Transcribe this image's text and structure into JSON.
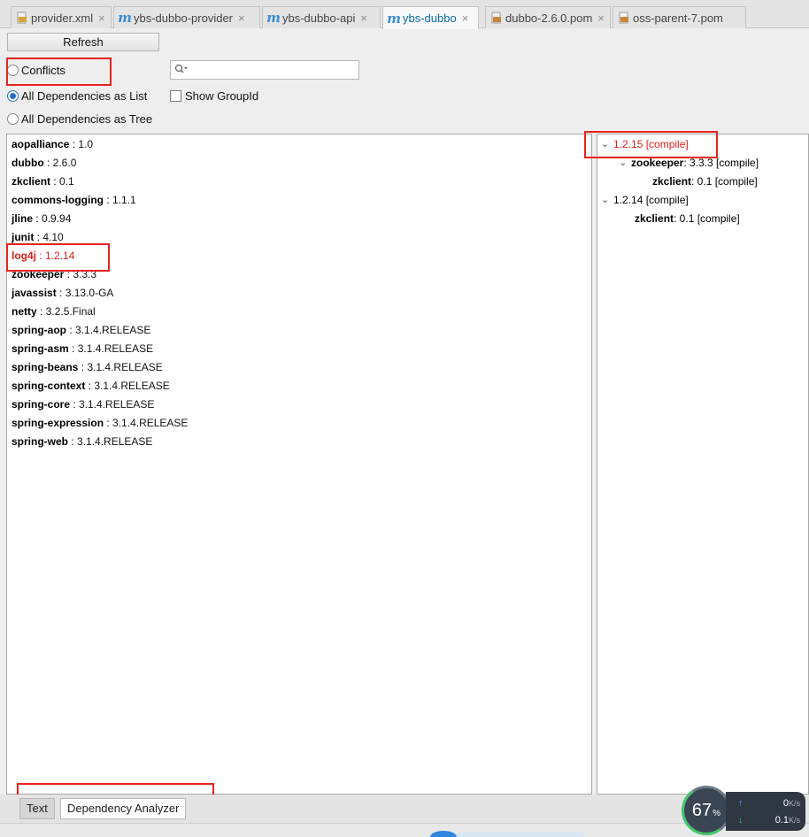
{
  "tabs": [
    {
      "label": "provider.xml",
      "icon": "xml-file-icon"
    },
    {
      "label": "ybs-dubbo-provider",
      "icon": "maven-icon"
    },
    {
      "label": "ybs-dubbo-api",
      "icon": "maven-icon"
    },
    {
      "label": "ybs-dubbo",
      "icon": "maven-icon",
      "active": true
    },
    {
      "label": "dubbo-2.6.0.pom",
      "icon": "pom-file-icon"
    },
    {
      "label": "oss-parent-7.pom",
      "icon": "pom-file-icon"
    }
  ],
  "tab_close_glyph": "×",
  "toolbar": {
    "refresh_label": "Refresh",
    "conflicts_label": "Conflicts",
    "list_label": "All Dependencies as List",
    "tree_label": "All Dependencies as Tree",
    "show_groupid_label": "Show GroupId",
    "view_mode": "list",
    "show_groupid": false,
    "search_value": ""
  },
  "dependencies": [
    {
      "name": "aopalliance",
      "sep": " : ",
      "version": "1.0"
    },
    {
      "name": "dubbo",
      "sep": " : ",
      "version": "2.6.0"
    },
    {
      "name": "zkclient",
      "sep": " : ",
      "version": "0.1"
    },
    {
      "name": "commons-logging",
      "sep": " : ",
      "version": "1.1.1"
    },
    {
      "name": "jline",
      "sep": " : ",
      "version": "0.9.94"
    },
    {
      "name": "junit",
      "sep": " : ",
      "version": "4.10"
    },
    {
      "name": "log4j",
      "sep": " : ",
      "version": "1.2.14",
      "conflict": true
    },
    {
      "name": "zookeeper",
      "sep": " : ",
      "version": "3.3.3"
    },
    {
      "name": "javassist",
      "sep": " : ",
      "version": "3.13.0-GA"
    },
    {
      "name": "netty",
      "sep": " : ",
      "version": "3.2.5.Final"
    },
    {
      "name": "spring-aop",
      "sep": " : ",
      "version": "3.1.4.RELEASE"
    },
    {
      "name": "spring-asm",
      "sep": " : ",
      "version": "3.1.4.RELEASE"
    },
    {
      "name": "spring-beans",
      "sep": " : ",
      "version": "3.1.4.RELEASE"
    },
    {
      "name": "spring-context",
      "sep": " : ",
      "version": "3.1.4.RELEASE"
    },
    {
      "name": "spring-core",
      "sep": " : ",
      "version": "3.1.4.RELEASE"
    },
    {
      "name": "spring-expression",
      "sep": " : ",
      "version": "3.1.4.RELEASE"
    },
    {
      "name": "spring-web",
      "sep": " : ",
      "version": "3.1.4.RELEASE"
    }
  ],
  "usages_tree": [
    {
      "label": "1.2.15 [compile]",
      "conflict": true,
      "expanded": true
    },
    {
      "name": "zookeeper",
      "rest": " : 3.3.3 [compile]",
      "expanded": true
    },
    {
      "name": "zkclient",
      "rest": " : 0.1 [compile]"
    },
    {
      "label": "1.2.14 [compile]",
      "expanded": true
    },
    {
      "name": "zkclient",
      "rest": " : 0.1 [compile]"
    }
  ],
  "bottom_tabs": [
    "Text",
    "Dependency Analyzer"
  ],
  "network_widget": {
    "cpu_value": "67",
    "cpu_unit": "%",
    "upload": "0",
    "upload_unit": "K/s",
    "download": "0.1",
    "download_unit": "K/s",
    "up_arrow": "↑",
    "down_arrow": "↓"
  },
  "colors": {
    "conflict_red": "#e0201a",
    "highlight_red": "#e8231f",
    "active_tab_text": "#0b6aa9"
  }
}
